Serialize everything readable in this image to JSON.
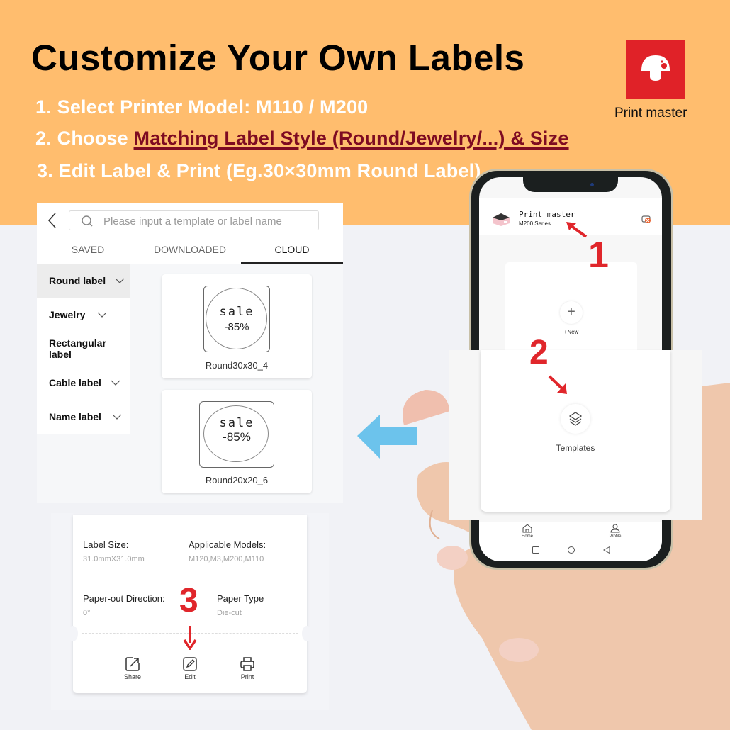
{
  "banner": {
    "headline": "Customize Your Own Labels",
    "step1": "1. Select Printer Model: M110 / M200",
    "step2_prefix": "2. Choose ",
    "step2_highlight": "Matching Label Style (Round/Jewelry/...) & Size",
    "step3": "3. Edit Label & Print (Eg.30×30mm Round Label)",
    "logo_icon": "mushroom-icon",
    "logo_text": "Print master",
    "colors": {
      "background": "#ffbd6e",
      "logo": "#e02228",
      "highlight": "#7e0b22",
      "step_markers": "#e0262b",
      "arrow": "#6cc3ec"
    }
  },
  "template_screen": {
    "search_placeholder": "Please input a template or label name",
    "tabs": [
      {
        "label": "SAVED",
        "active": false
      },
      {
        "label": "DOWNLOADED",
        "active": false
      },
      {
        "label": "CLOUD",
        "active": true
      }
    ],
    "categories": [
      {
        "label": "Round label",
        "active": true,
        "expandable": true
      },
      {
        "label": "Jewelry",
        "active": false,
        "expandable": true
      },
      {
        "label": "Rectangular label",
        "active": false,
        "expandable": false
      },
      {
        "label": "Cable label",
        "active": false,
        "expandable": true
      },
      {
        "label": "Name label",
        "active": false,
        "expandable": true
      }
    ],
    "templates": [
      {
        "name": "Round30x30_4",
        "line1": "sale",
        "line2": "-85%"
      },
      {
        "name": "Round20x20_6",
        "line1": "sale",
        "line2": "-85%"
      }
    ]
  },
  "detail_screen": {
    "label_size_label": "Label Size:",
    "label_size_value": "31.0mmX31.0mm",
    "models_label": "Applicable Models:",
    "models_value": "M120,M3,M200,M110",
    "direction_label": "Paper-out Direction:",
    "direction_value": "0°",
    "paper_type_label": "Paper Type",
    "paper_type_value": "Die-cut",
    "actions": [
      {
        "label": "Share",
        "icon": "share-icon"
      },
      {
        "label": "Edit",
        "icon": "edit-icon"
      },
      {
        "label": "Print",
        "icon": "printer-icon"
      }
    ]
  },
  "phone_screen": {
    "app_title": "Print master",
    "printer_series": "M200 Series",
    "new_label": "+New",
    "templates_label": "Templates",
    "nav": [
      {
        "label": "Home",
        "icon": "home-icon"
      },
      {
        "label": "Profile",
        "icon": "profile-icon"
      }
    ]
  },
  "markers": {
    "one": "1",
    "two": "2",
    "three": "3"
  }
}
